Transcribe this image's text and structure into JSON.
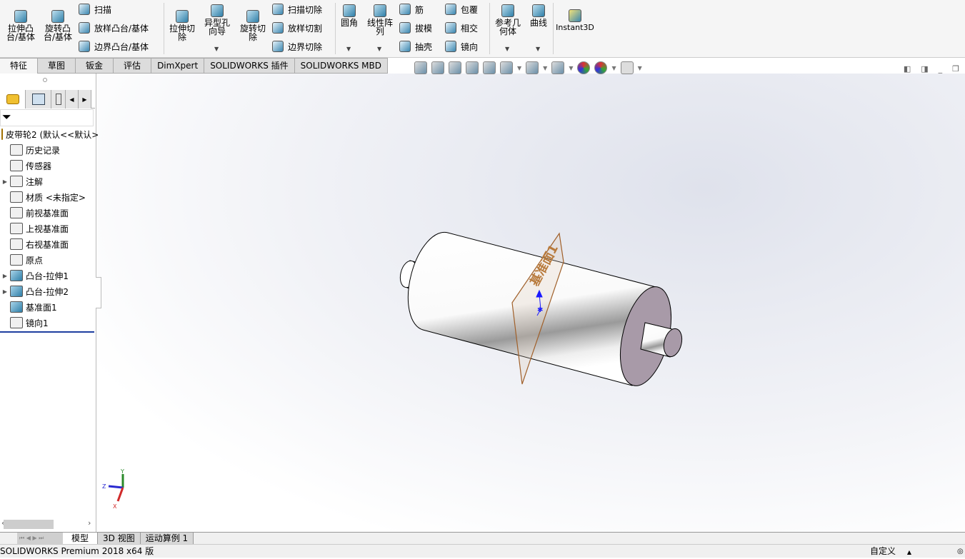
{
  "ribbon": {
    "extrude_boss": "拉伸凸台/基体",
    "revolve_boss": "旋转凸台/基体",
    "sweep": "扫描",
    "loft_boss": "放样凸台/基体",
    "boundary_boss": "边界凸台/基体",
    "extrude_cut": "拉伸切除",
    "hole_wizard": "异型孔向导",
    "revolve_cut": "旋转切除",
    "swept_cut": "扫描切除",
    "lofted_cut": "放样切割",
    "boundary_cut": "边界切除",
    "fillet": "圆角",
    "linear_pattern": "线性阵列",
    "rib": "筋",
    "draft": "拔模",
    "shell": "抽壳",
    "wrap": "包覆",
    "intersect": "相交",
    "mirror": "镜向",
    "ref_geometry": "参考几何体",
    "curves": "曲线",
    "instant3d": "Instant3D"
  },
  "tabs": [
    "特征",
    "草图",
    "钣金",
    "评估",
    "DimXpert",
    "SOLIDWORKS 插件",
    "SOLIDWORKS MBD"
  ],
  "tree": {
    "root": "皮带轮2 (默认<<默认>",
    "items": [
      {
        "label": "历史记录",
        "expand": false
      },
      {
        "label": "传感器",
        "expand": false
      },
      {
        "label": "注解",
        "expand": true
      },
      {
        "label": "材质 <未指定>",
        "expand": false
      },
      {
        "label": "前视基准面",
        "expand": false
      },
      {
        "label": "上视基准面",
        "expand": false
      },
      {
        "label": "右视基准面",
        "expand": false
      },
      {
        "label": "原点",
        "expand": false
      },
      {
        "label": "凸台-拉伸1",
        "expand": true
      },
      {
        "label": "凸台-拉伸2",
        "expand": true
      },
      {
        "label": "基准面1",
        "expand": false
      },
      {
        "label": "镜向1",
        "expand": false
      }
    ]
  },
  "viewport": {
    "plane_label": "基准面1",
    "triad": {
      "x": "X",
      "y": "Y",
      "z": "Z"
    }
  },
  "bottom_tabs": [
    "模型",
    "3D 视图",
    "运动算例 1"
  ],
  "status": {
    "product": "SOLIDWORKS Premium 2018 x64 版",
    "units": "自定义"
  },
  "colors": {
    "plane": "#a0602a",
    "end_face": "#a89aa8",
    "accent": "#1f3fa0"
  }
}
